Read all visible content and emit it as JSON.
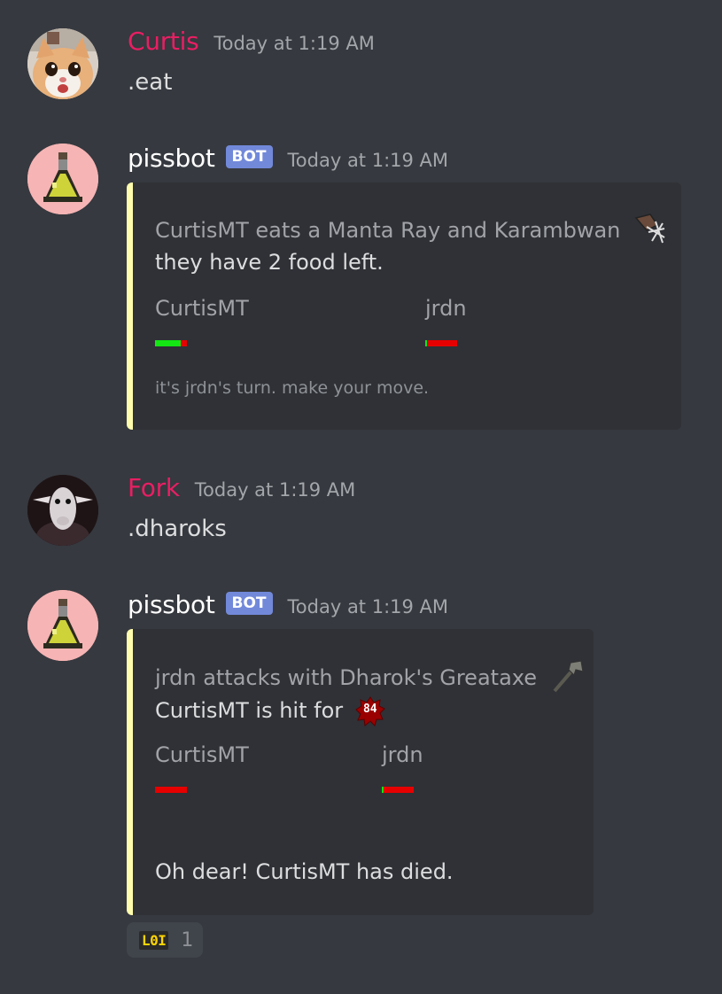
{
  "colors": {
    "background": "#36393f",
    "embed_background": "#2f3136",
    "embed_border": "#fffcae",
    "username_pink": "#e91e63",
    "bot_tag": "#7289da",
    "hp_green": "#14e614",
    "hp_red": "#e60000"
  },
  "messages": [
    {
      "author": "Curtis",
      "timestamp": "Today at 1:19 AM",
      "avatar": "cat-avatar",
      "content": ".eat"
    },
    {
      "author": "pissbot",
      "bot_tag": "BOT",
      "timestamp": "Today at 1:19 AM",
      "avatar": "potion-avatar",
      "embed": {
        "title": "CurtisMT eats a Manta Ray and Karambwan",
        "title_icon": "karambwan-food-icon",
        "description": "they have 2 food left.",
        "fields": [
          {
            "name": "CurtisMT",
            "hp_fraction": 0.8
          },
          {
            "name": "jrdn",
            "hp_fraction": 0.06
          }
        ],
        "footer": "it's jrdn's turn. make your move."
      }
    },
    {
      "author": "Fork",
      "timestamp": "Today at 1:19 AM",
      "avatar": "goat-avatar",
      "content": ".dharoks"
    },
    {
      "author": "pissbot",
      "bot_tag": "BOT",
      "timestamp": "Today at 1:19 AM",
      "avatar": "potion-avatar",
      "embed": {
        "title": "jrdn attacks with Dharok's Greataxe",
        "title_icon": "greataxe-icon",
        "description": "CurtisMT is hit for",
        "hitsplat": "84",
        "fields": [
          {
            "name": "CurtisMT",
            "hp_fraction": 0.0
          },
          {
            "name": "jrdn",
            "hp_fraction": 0.06
          }
        ],
        "footer": "Oh dear! CurtisMT has died."
      }
    }
  ],
  "reaction": {
    "emoji_text": "L0I",
    "count": "1"
  }
}
